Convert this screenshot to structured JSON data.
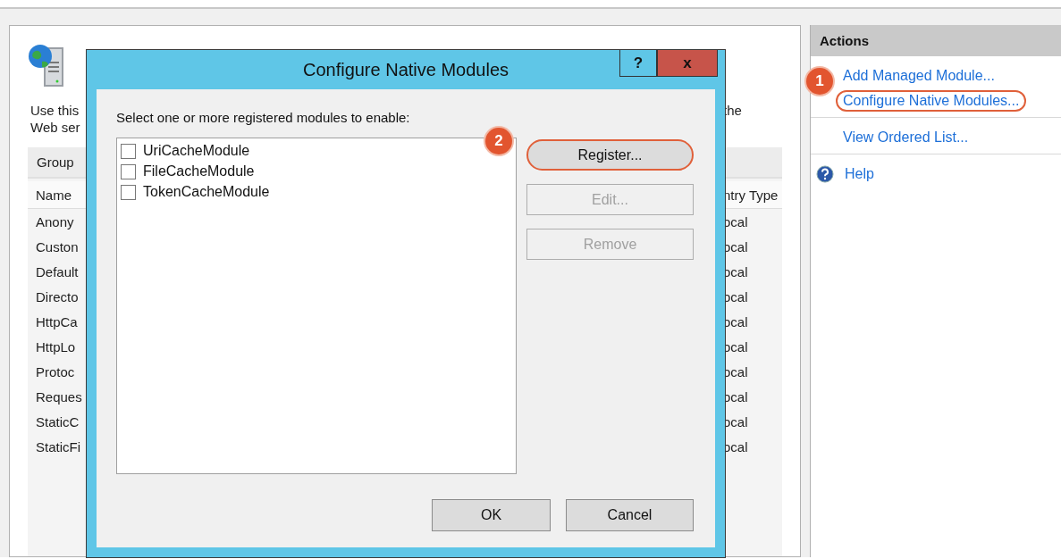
{
  "main_panel": {
    "description_lines": [
      {
        "left": "Use this",
        "right": "the"
      },
      {
        "left": "Web ser"
      }
    ],
    "group_header": "Group",
    "table": {
      "columns": [
        "Name",
        "ntry Type"
      ],
      "rows": [
        {
          "name": "Anony",
          "type": "ocal"
        },
        {
          "name": "Custon",
          "type": "ocal"
        },
        {
          "name": "Default",
          "type": "ocal"
        },
        {
          "name": "Directo",
          "type": "ocal"
        },
        {
          "name": "HttpCa",
          "type": "ocal"
        },
        {
          "name": "HttpLo",
          "type": "ocal"
        },
        {
          "name": "Protoc",
          "type": "ocal"
        },
        {
          "name": "Reques",
          "type": "ocal"
        },
        {
          "name": "StaticC",
          "type": "ocal"
        },
        {
          "name": "StaticFi",
          "type": "ocal"
        }
      ]
    }
  },
  "dialog": {
    "title": "Configure Native Modules",
    "title_buttons": [
      {
        "kind": "help",
        "label": "?"
      },
      {
        "kind": "close",
        "label": "x"
      }
    ],
    "prompt": "Select one or more registered modules to enable:",
    "modules": [
      {
        "label": "UriCacheModule",
        "checked": false
      },
      {
        "label": "FileCacheModule",
        "checked": false
      },
      {
        "label": "TokenCacheModule",
        "checked": false
      }
    ],
    "side_buttons": [
      {
        "label": "Register...",
        "disabled": false,
        "highlighted": true
      },
      {
        "label": "Edit...",
        "disabled": true,
        "highlighted": false
      },
      {
        "label": "Remove",
        "disabled": true,
        "highlighted": false
      }
    ],
    "footer_buttons": [
      "OK",
      "Cancel"
    ],
    "badge": "2"
  },
  "actions": {
    "title": "Actions",
    "badge": "1",
    "groups": [
      [
        {
          "kind": "link",
          "label": "Add Managed Module...",
          "highlighted": false
        },
        {
          "kind": "link",
          "label": "Configure Native Modules...",
          "highlighted": true
        }
      ],
      [
        {
          "kind": "link",
          "label": "View Ordered List...",
          "highlighted": false
        }
      ],
      [
        {
          "kind": "help",
          "label": "Help",
          "highlighted": false
        }
      ]
    ]
  }
}
